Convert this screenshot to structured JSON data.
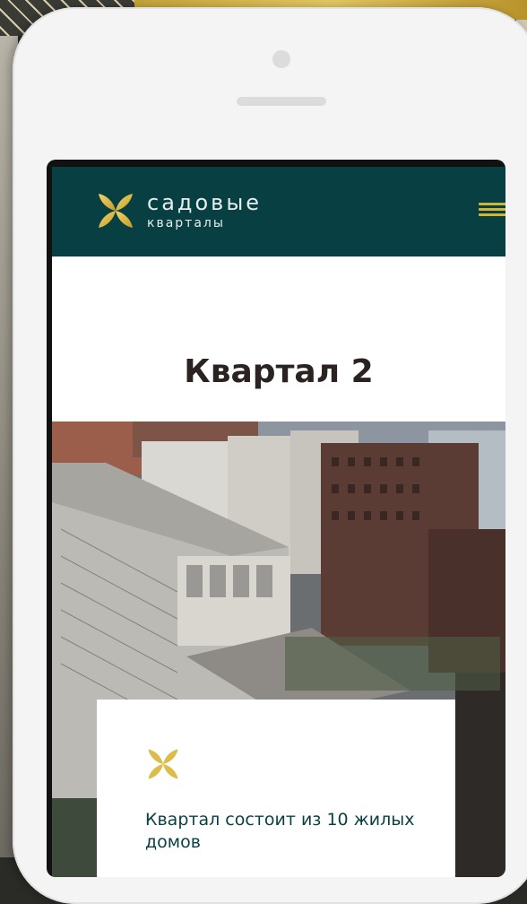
{
  "brand": {
    "name": "садовые",
    "subtitle": "кварталы"
  },
  "header": {
    "menu_icon": "hamburger-icon"
  },
  "page": {
    "title": "Квартал 2"
  },
  "card": {
    "icon": "flower-icon",
    "text": "Квартал состоит из 10 жилых домов"
  },
  "colors": {
    "header_bg": "#073f43",
    "accent_gold": "#d3b437",
    "title_text": "#2a2321",
    "card_text": "#083f44"
  }
}
